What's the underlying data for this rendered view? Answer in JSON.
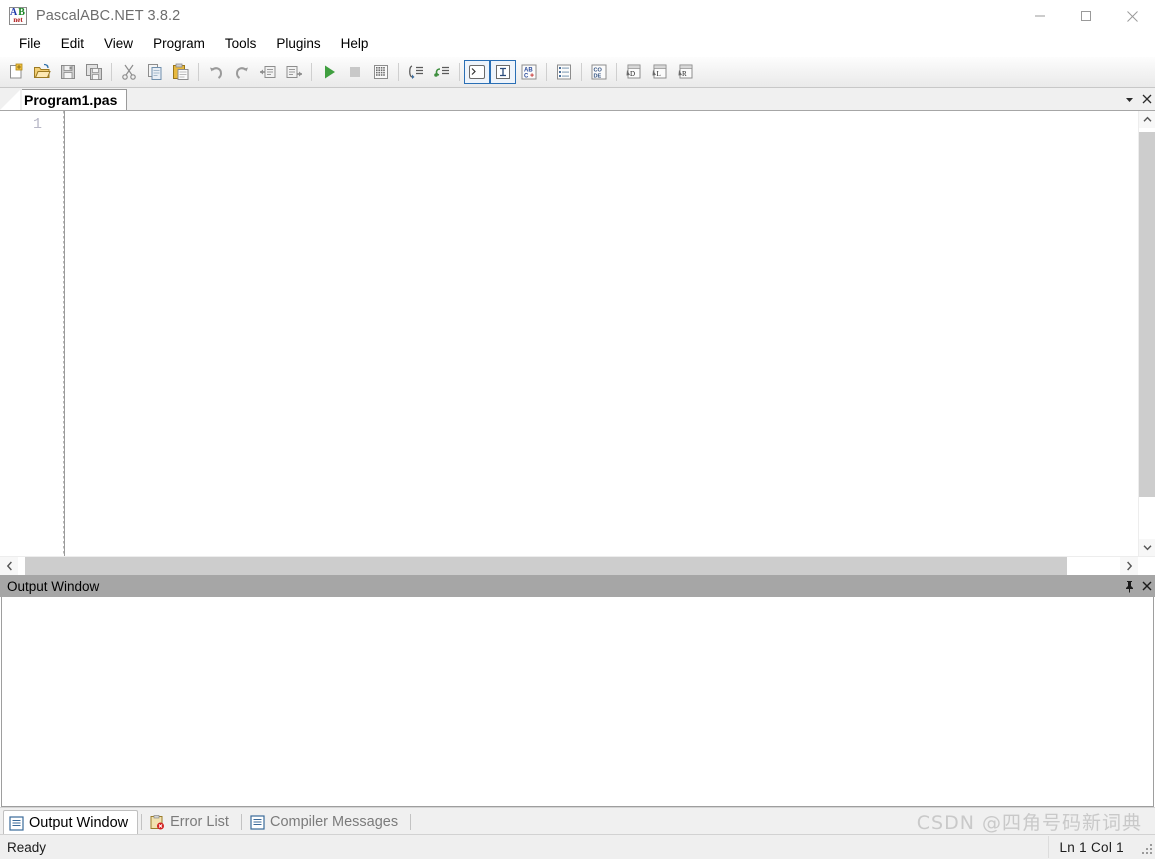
{
  "window": {
    "title": "PascalABC.NET 3.8.2",
    "app_icon": "pascalabc-net-icon",
    "icon_letters": {
      "a": "A",
      "b": "B",
      "net": "net"
    },
    "controls": {
      "minimize": "minimize",
      "maximize": "maximize",
      "close": "close"
    }
  },
  "menubar": {
    "items": [
      {
        "label": "File"
      },
      {
        "label": "Edit"
      },
      {
        "label": "View"
      },
      {
        "label": "Program"
      },
      {
        "label": "Tools"
      },
      {
        "label": "Plugins"
      },
      {
        "label": "Help"
      }
    ]
  },
  "toolbar": {
    "groups": [
      {
        "buttons": [
          {
            "icon": "new-file-icon",
            "tooltip": "New"
          },
          {
            "icon": "open-folder-icon",
            "tooltip": "Open"
          },
          {
            "icon": "save-icon",
            "tooltip": "Save"
          },
          {
            "icon": "save-all-icon",
            "tooltip": "Save All"
          }
        ]
      },
      {
        "buttons": [
          {
            "icon": "cut-scissors-icon",
            "tooltip": "Cut"
          },
          {
            "icon": "copy-icon",
            "tooltip": "Copy"
          },
          {
            "icon": "paste-clipboard-icon",
            "tooltip": "Paste"
          }
        ]
      },
      {
        "buttons": [
          {
            "icon": "undo-arrow-icon",
            "tooltip": "Undo"
          },
          {
            "icon": "redo-arrow-icon",
            "tooltip": "Redo"
          },
          {
            "icon": "comment-block-icon",
            "tooltip": "Comment"
          },
          {
            "icon": "uncomment-block-icon",
            "tooltip": "Uncomment"
          }
        ]
      },
      {
        "buttons": [
          {
            "icon": "run-play-icon",
            "tooltip": "Run"
          },
          {
            "icon": "stop-square-icon",
            "tooltip": "Stop"
          },
          {
            "icon": "build-icon",
            "tooltip": "Build"
          }
        ]
      },
      {
        "buttons": [
          {
            "icon": "step-into-icon",
            "tooltip": "Step Into"
          },
          {
            "icon": "step-over-icon",
            "tooltip": "Step Over"
          }
        ]
      },
      {
        "buttons": [
          {
            "icon": "console-window-icon",
            "tooltip": "Console Window",
            "toggled": true
          },
          {
            "icon": "text-cursor-icon",
            "tooltip": "Input",
            "toggled": true
          },
          {
            "icon": "abc-plus-icon",
            "tooltip": "Spell"
          }
        ]
      },
      {
        "buttons": [
          {
            "icon": "list-panel-icon",
            "tooltip": "Panel"
          }
        ]
      },
      {
        "buttons": [
          {
            "icon": "code-icon",
            "tooltip": "Code"
          }
        ]
      },
      {
        "buttons": [
          {
            "icon": "page-d-icon",
            "tooltip": "D"
          },
          {
            "icon": "page-l-icon",
            "tooltip": "L"
          },
          {
            "icon": "page-r-icon",
            "tooltip": "R"
          }
        ]
      }
    ]
  },
  "editor": {
    "tab": {
      "label": "Program1.pas",
      "active": true
    },
    "tab_controls": {
      "dropdown": "chevron-down-icon",
      "close": "close-icon"
    },
    "line_numbers": [
      "1"
    ],
    "content": "",
    "scrollbars": {
      "up_arrow": "⌃",
      "down_arrow": "⌄",
      "left_arrow": "‹",
      "right_arrow": "›"
    }
  },
  "output_panel": {
    "title": "Output Window",
    "header_buttons": {
      "pin": "pin-icon",
      "close": "close-icon"
    },
    "content": "",
    "tabs": [
      {
        "label": "Output Window",
        "icon": "output-window-icon",
        "active": true
      },
      {
        "label": "Error List",
        "icon": "error-list-icon",
        "active": false
      },
      {
        "label": "Compiler Messages",
        "icon": "compiler-messages-icon",
        "active": false
      }
    ]
  },
  "statusbar": {
    "status": "Ready",
    "position": "Ln 1 Col 1",
    "grip": "resize-grip-icon"
  },
  "watermark": {
    "text": "CSDN @四角号码新词典"
  },
  "colors": {
    "accent_blue": "#2a6fb5",
    "panel_header": "#a6a6a6",
    "toolbar_bg": "#f3f3f3",
    "statusbar_bg": "#efefef"
  }
}
